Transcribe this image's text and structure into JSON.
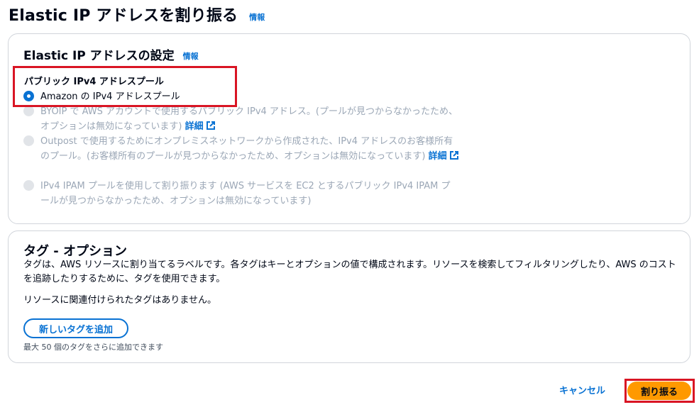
{
  "page": {
    "title": "Elastic IP アドレスを割り振る",
    "info_label": "情報"
  },
  "settings": {
    "title": "Elastic IP アドレスの設定",
    "info_label": "情報",
    "pool_label": "パブリック IPv4 アドレスプール",
    "options": [
      {
        "label": "Amazon の IPv4 アドレスプール",
        "selected": true,
        "disabled": false
      },
      {
        "label": "BYOIP で AWS アカウントで使用するパブリック IPv4 アドレス。(プールが見つからなかったため、オプションは無効になっています)",
        "link": "詳細",
        "selected": false,
        "disabled": true
      },
      {
        "label": "Outpost で使用するためにオンプレミスネットワークから作成された、IPv4 アドレスのお客様所有のプール。(お客様所有のプールが見つからなかったため、オプションは無効になっています)",
        "link": "詳細",
        "selected": false,
        "disabled": true
      },
      {
        "label": "IPv4 IPAM プールを使用して割り振ります (AWS サービスを EC2 とするパブリック IPv4 IPAM プールが見つからなかったため、オプションは無効になっています)",
        "selected": false,
        "disabled": true
      }
    ]
  },
  "tags": {
    "title": "タグ - オプション",
    "description": "タグは、AWS リソースに割り当てるラベルです。各タグはキーとオプションの値で構成されます。リソースを検索してフィルタリングしたり、AWS のコストを追跡したりするために、タグを使用できます。",
    "empty_text": "リソースに関連付けられたタグはありません。",
    "add_button": "新しいタグを追加",
    "limit_hint": "最大 50 個のタグをさらに追加できます"
  },
  "footer": {
    "cancel": "キャンセル",
    "submit": "割り振る"
  },
  "colors": {
    "accent": "#0972d3",
    "primary_button": "#ff9900",
    "highlight_box": "#d91524",
    "disabled_text": "#9ba7b6"
  }
}
